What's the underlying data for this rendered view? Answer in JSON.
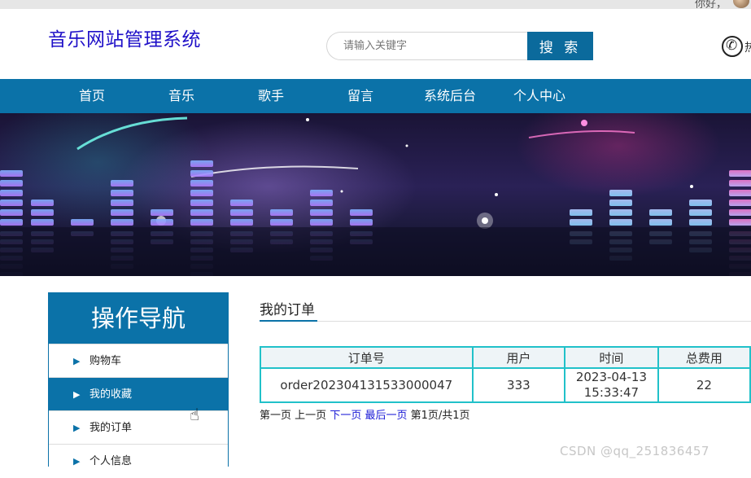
{
  "topbar": {
    "greeting": "你好，"
  },
  "header": {
    "logo": "音乐网站管理系统",
    "search_placeholder": "请输入关键字",
    "search_button": "搜 索",
    "phone_text": "热"
  },
  "nav": {
    "items": [
      "首页",
      "音乐",
      "歌手",
      "留言",
      "系统后台",
      "个人中心"
    ]
  },
  "sidebar": {
    "title": "操作导航",
    "items": [
      "购物车",
      "我的收藏",
      "我的订单",
      "个人信息"
    ],
    "active_index": 1
  },
  "main": {
    "title": "我的订单",
    "table": {
      "headers": [
        "订单号",
        "用户",
        "时间",
        "总费用"
      ],
      "rows": [
        [
          "order202304131533000047",
          "333",
          "2023-04-13 15:33:47",
          "22"
        ]
      ]
    },
    "pager": {
      "first": "第一页",
      "prev": "上一页",
      "next": "下一页",
      "last": "最后一页",
      "status": "第1页/共1页"
    }
  },
  "watermark": "CSDN @qq_251836457",
  "colors": {
    "brand": "#0b72a8",
    "logo": "#1f10c8",
    "table_border": "#21c1c9"
  }
}
